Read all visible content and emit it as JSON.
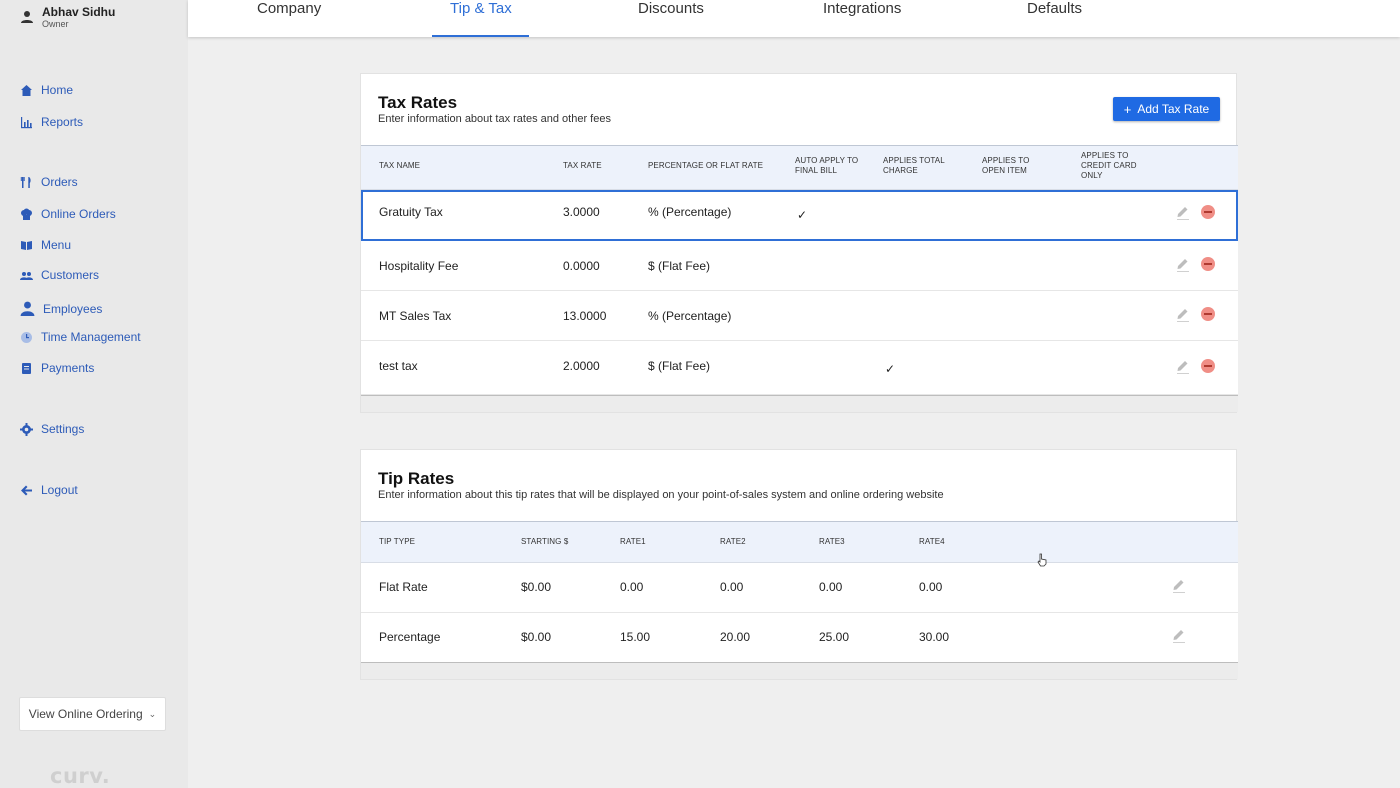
{
  "user": {
    "name": "Abhav Sidhu",
    "role": "Owner"
  },
  "sidebar": {
    "items": [
      {
        "label": "Home",
        "icon": "home-icon"
      },
      {
        "label": "Reports",
        "icon": "chart-icon"
      },
      {
        "label": "Orders",
        "icon": "utensils-icon"
      },
      {
        "label": "Online Orders",
        "icon": "chef-hat-icon"
      },
      {
        "label": "Menu",
        "icon": "book-icon"
      },
      {
        "label": "Customers",
        "icon": "people-icon"
      },
      {
        "label": "Employees",
        "icon": "person-icon"
      },
      {
        "label": "Time Management",
        "icon": "clock-icon"
      },
      {
        "label": "Payments",
        "icon": "receipt-icon"
      },
      {
        "label": "Settings",
        "icon": "gear-icon"
      },
      {
        "label": "Logout",
        "icon": "arrow-left-icon"
      }
    ],
    "view_online_ordering": "View Online Ordering",
    "logo": "curv."
  },
  "tabs": [
    {
      "label": "Company"
    },
    {
      "label": "Tip & Tax",
      "active": true
    },
    {
      "label": "Discounts"
    },
    {
      "label": "Integrations"
    },
    {
      "label": "Defaults"
    }
  ],
  "tax_rates": {
    "title": "Tax Rates",
    "subtitle": "Enter information about tax rates and other fees",
    "add_button": "Add Tax Rate",
    "columns": {
      "name": "TAX NAME",
      "rate": "TAX RATE",
      "type": "PERCENTAGE OR FLAT RATE",
      "auto_apply": "AUTO APPLY TO FINAL BILL",
      "total_charge": "APPLIES TOTAL CHARGE",
      "open_item": "APPLIES TO OPEN ITEM",
      "credit_card": "APPLIES TO CREDIT CARD ONLY"
    },
    "rows": [
      {
        "name": "Gratuity Tax",
        "rate": "3.0000",
        "type": "% (Percentage)",
        "auto_apply": "✓",
        "total_charge": ""
      },
      {
        "name": "Hospitality Fee",
        "rate": "0.0000",
        "type": "$ (Flat Fee)",
        "auto_apply": "",
        "total_charge": ""
      },
      {
        "name": "MT Sales Tax",
        "rate": "13.0000",
        "type": "% (Percentage)",
        "auto_apply": "",
        "total_charge": ""
      },
      {
        "name": "test tax",
        "rate": "2.0000",
        "type": "$ (Flat Fee)",
        "auto_apply": "",
        "total_charge": "✓"
      }
    ]
  },
  "tip_rates": {
    "title": "Tip Rates",
    "subtitle": "Enter information about this tip rates that will be displayed on your point-of-sales system and online ordering website",
    "columns": {
      "type": "TIP TYPE",
      "starting": "STARTING $",
      "rate1": "RATE1",
      "rate2": "RATE2",
      "rate3": "RATE3",
      "rate4": "RATE4"
    },
    "rows": [
      {
        "type": "Flat Rate",
        "starting": "$0.00",
        "rate1": "0.00",
        "rate2": "0.00",
        "rate3": "0.00",
        "rate4": "0.00"
      },
      {
        "type": "Percentage",
        "starting": "$0.00",
        "rate1": "15.00",
        "rate2": "20.00",
        "rate3": "25.00",
        "rate4": "30.00"
      }
    ]
  },
  "colors": {
    "accent": "#2f6fd6",
    "button": "#1f6ae3",
    "delete": "#f08e86",
    "sidebar_bg": "#e9e9e9",
    "header_row_bg": "#edf2fb"
  }
}
